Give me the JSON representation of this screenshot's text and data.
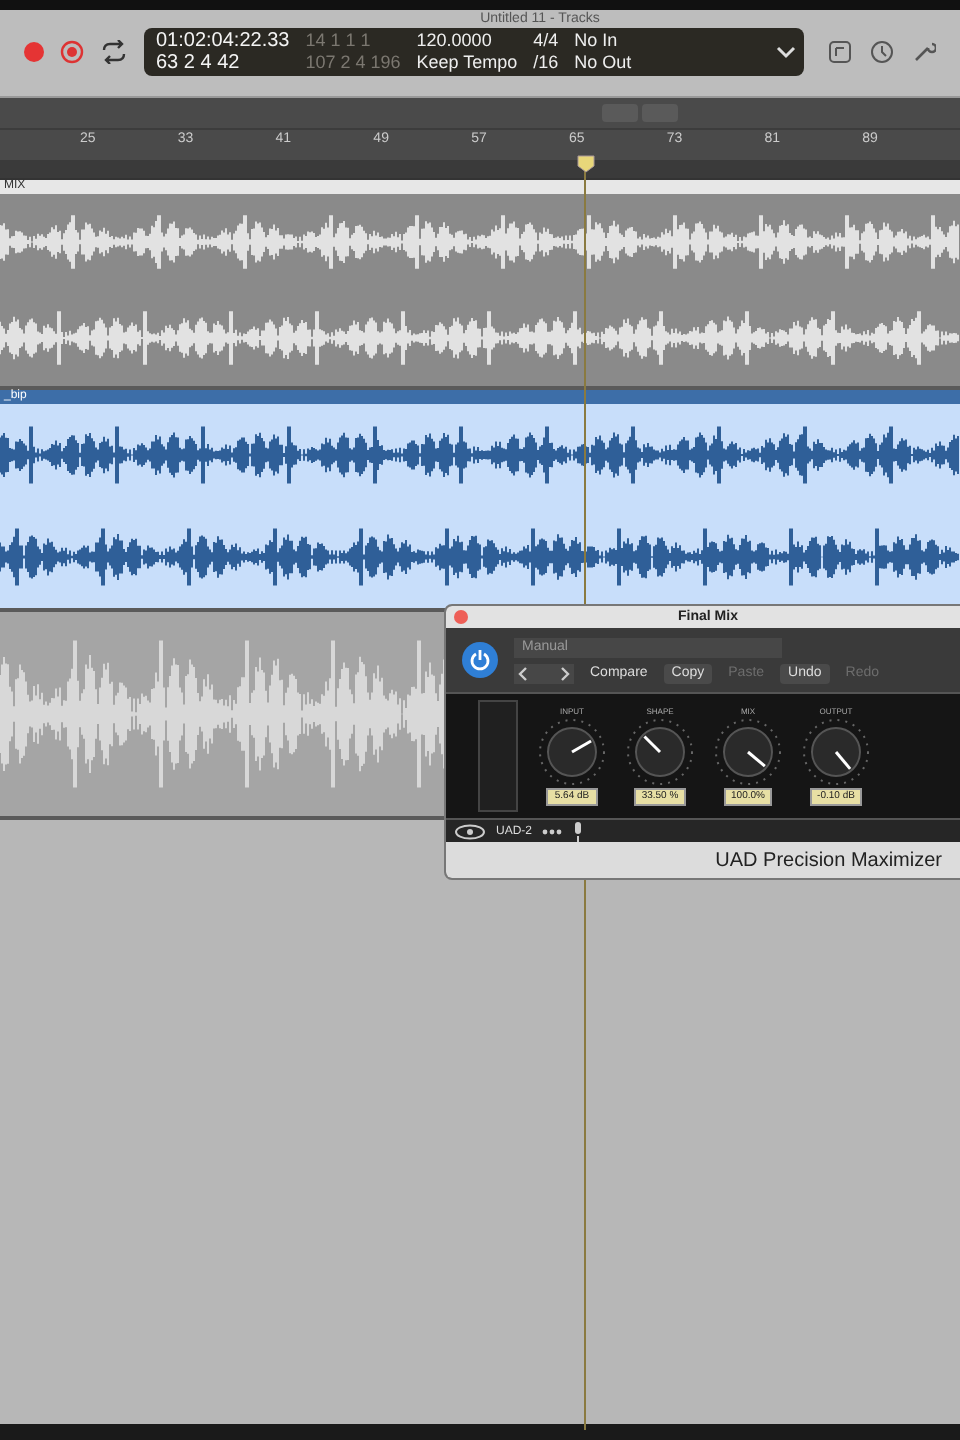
{
  "window": {
    "title": "Untitled 11 - Tracks"
  },
  "lcd": {
    "time": "01:02:04:22.33",
    "bars": "63 2 4 42",
    "locator_start": "14 1 1 1",
    "locator_end": "107 2 4 196",
    "tempo": "120.0000",
    "tempo_mode": "Keep Tempo",
    "signature": "4/4",
    "division": "/16",
    "input": "No In",
    "output": "No Out"
  },
  "ruler": [
    "25",
    "33",
    "41",
    "49",
    "57",
    "65",
    "73",
    "81",
    "89"
  ],
  "tracks": [
    {
      "name": "MIX",
      "selected": false
    },
    {
      "name": "_bip",
      "selected": true
    },
    {
      "selected": false
    }
  ],
  "plugin": {
    "title": "Final Mix",
    "power_on": true,
    "preset": "Manual",
    "buttons": [
      {
        "label": "Compare",
        "disabled": false
      },
      {
        "label": "Copy",
        "disabled": false
      },
      {
        "label": "Paste",
        "disabled": true
      },
      {
        "label": "Undo",
        "disabled": false
      },
      {
        "label": "Redo",
        "disabled": true
      }
    ],
    "knobs": [
      {
        "label": "INPUT",
        "reading": "5.64 dB"
      },
      {
        "label": "SHAPE",
        "reading": "33.50 %"
      },
      {
        "label": "MIX",
        "reading": "100.0%"
      },
      {
        "label": "OUTPUT",
        "reading": "-0.10 dB"
      }
    ],
    "footer": "UAD-2",
    "name": "UAD Precision Maximizer"
  }
}
